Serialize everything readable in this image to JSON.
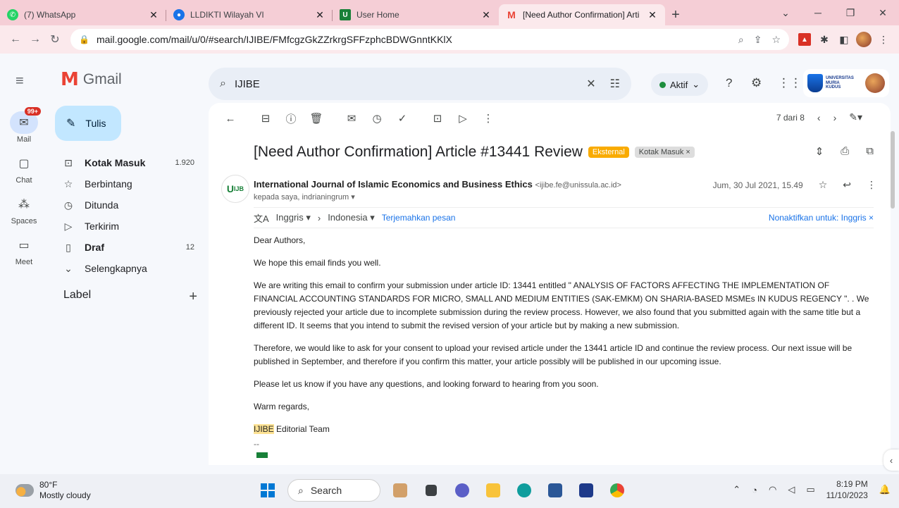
{
  "browser": {
    "tabs": [
      {
        "title": "(7) WhatsApp",
        "favicon": "whatsapp-icon",
        "color": "#25d366",
        "active": false
      },
      {
        "title": "LLDIKTI Wilayah VI",
        "favicon": "lldikti-icon",
        "color": "#1a73e8",
        "active": false
      },
      {
        "title": "User Home",
        "favicon": "ijibe-icon",
        "color": "#188038",
        "active": false
      },
      {
        "title": "[Need Author Confirmation] Arti",
        "favicon": "gmail-icon",
        "color": "#ea4335",
        "active": true
      }
    ],
    "url": "mail.google.com/mail/u/0/#search/IJIBE/FMfcgzGkZZrkrgSFFzphcBDWGnntKKlX"
  },
  "gmail": {
    "rail": [
      {
        "label": "Mail",
        "badge": "99+",
        "icon": "mail-icon"
      },
      {
        "label": "Chat",
        "icon": "chat-icon"
      },
      {
        "label": "Spaces",
        "icon": "spaces-icon"
      },
      {
        "label": "Meet",
        "icon": "meet-icon"
      }
    ],
    "logo_text": "Gmail",
    "compose_label": "Tulis",
    "nav": [
      {
        "label": "Kotak Masuk",
        "count": "1.920",
        "icon": "inbox-icon",
        "bold": true
      },
      {
        "label": "Berbintang",
        "count": "",
        "icon": "star-icon",
        "bold": false
      },
      {
        "label": "Ditunda",
        "count": "",
        "icon": "snooze-icon",
        "bold": false
      },
      {
        "label": "Terkirim",
        "count": "",
        "icon": "send-icon",
        "bold": false
      },
      {
        "label": "Draf",
        "count": "12",
        "icon": "draft-icon",
        "bold": true
      },
      {
        "label": "Selengkapnya",
        "count": "",
        "icon": "chevron-down-icon",
        "bold": false
      }
    ],
    "label_heading": "Label",
    "search_query": "IJIBE",
    "status": "Aktif",
    "university": "UNIVERSITAS MURIA KUDUS",
    "pager": "7 dari 8"
  },
  "message": {
    "subject": "[Need Author Confirmation] Article #13441 Review",
    "tag_external": "Eksternal",
    "tag_inbox": "Kotak Masuk",
    "sender_name": "International Journal of Islamic Economics and Business Ethics",
    "sender_email": "<ijibe.fe@unissula.ac.id>",
    "recipients": "kepada saya, indrianingrum",
    "date": "Jum, 30 Jul 2021, 15.49",
    "translate_from": "Inggris",
    "translate_to": "Indonesia",
    "translate_link": "Terjemahkan pesan",
    "translate_off": "Nonaktifkan untuk: Inggris",
    "greeting": "Dear Authors,",
    "p1": "We hope this email finds you well.",
    "p2": "We are writing this email to confirm your submission under article ID: 13441 entitled \" ANALYSIS OF FACTORS AFFECTING THE IMPLEMENTATION OF FINANCIAL ACCOUNTING STANDARDS FOR MICRO, SMALL AND MEDIUM ENTITIES (SAK-EMKM) ON SHARIA-BASED MSMEs IN KUDUS REGENCY \". . We previously rejected your article due to incomplete submission during the review process. However, we also found that you submitted again with the same title but a different ID. It seems that you intend to submit the revised version of your article but by making a new submission.",
    "p3": "Therefore, we would like to ask for your consent to upload your revised article under the 13441 article ID and continue the review process. Our next issue will be published in September, and therefore if you confirm this matter, your article possibly will be published in our upcoming issue.",
    "p4": "Please let us know if you have any questions, and looking forward to hearing from you soon.",
    "closing": "Warm regards,",
    "signature_highlight": "IJIBE",
    "signature_rest": " Editorial Team",
    "sig_rule": "--"
  },
  "taskbar": {
    "temp": "80°F",
    "weather": "Mostly cloudy",
    "search": "Search",
    "time": "8:19 PM",
    "date": "11/10/2023"
  }
}
